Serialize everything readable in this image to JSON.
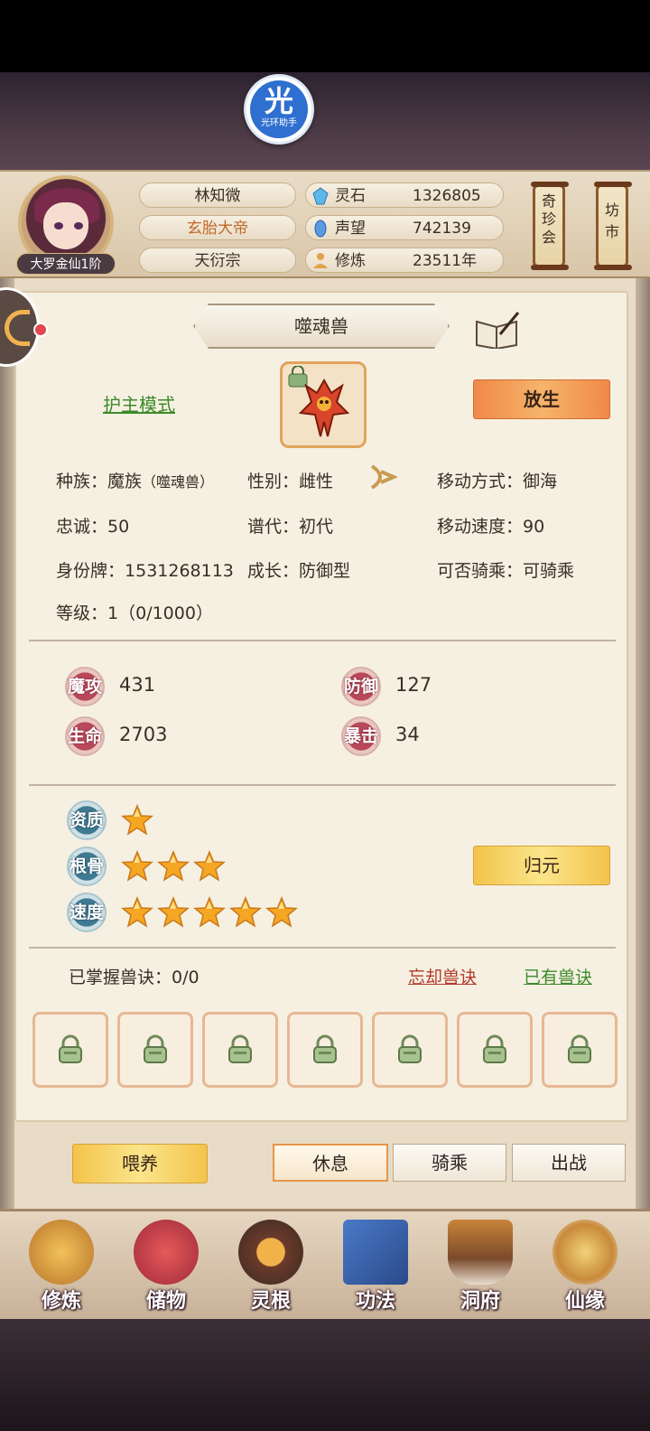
{
  "app_badge": {
    "glyph": "光",
    "text": "光环助手"
  },
  "player": {
    "rank": "大罗金仙1阶",
    "name": "林知微",
    "title": "玄胎大帝",
    "sect": "天衍宗"
  },
  "resources": [
    {
      "icon": "spirit-stone-icon",
      "label": "灵石",
      "value": "1326805"
    },
    {
      "icon": "reputation-icon",
      "label": "声望",
      "value": "742139"
    },
    {
      "icon": "cultivation-icon",
      "label": "修炼",
      "value": "23511年"
    }
  ],
  "scrolls": {
    "left": "奇珍会",
    "right": "坊市"
  },
  "beast": {
    "name": "噬魂兽",
    "mode_link": "护主模式",
    "release_button": "放生",
    "info": {
      "race_label": "种族：",
      "race_value": "魔族",
      "race_sub": "（噬魂兽）",
      "gender_label": "性别：",
      "gender_value": "雌性",
      "move_label": "移动方式：",
      "move_value": "御海",
      "loyalty_label": "忠诚：",
      "loyalty_value": "50",
      "gen_label": "谱代：",
      "gen_value": "初代",
      "speed_label": "移动速度：",
      "speed_value": "90",
      "id_label": "身份牌：",
      "id_value": "1531268113",
      "growth_label": "成长：",
      "growth_value": "防御型",
      "ride_label": "可否骑乘：",
      "ride_value": "可骑乘",
      "level_label": "等级：",
      "level_value": "1（0/1000）"
    },
    "stats": [
      {
        "name": "魔攻",
        "value": "431"
      },
      {
        "name": "防御",
        "value": "127"
      },
      {
        "name": "生命",
        "value": "2703"
      },
      {
        "name": "暴击",
        "value": "34"
      }
    ],
    "aptitudes": [
      {
        "name": "资质",
        "stars": 1
      },
      {
        "name": "根骨",
        "stars": 3
      },
      {
        "name": "速度",
        "stars": 5
      }
    ],
    "return_button": "归元",
    "skills": {
      "label": "已掌握兽诀：0/0",
      "forget_link": "忘却兽诀",
      "owned_link": "已有兽诀",
      "slot_count": 7
    }
  },
  "actions": {
    "feed": "喂养",
    "tabs": [
      "休息",
      "骑乘",
      "出战"
    ],
    "active_tab": "休息"
  },
  "nav": [
    {
      "label": "修炼",
      "icon": "cultivate-icon"
    },
    {
      "label": "储物",
      "icon": "storage-bag-icon"
    },
    {
      "label": "灵根",
      "icon": "spirit-root-icon"
    },
    {
      "label": "功法",
      "icon": "technique-book-icon"
    },
    {
      "label": "洞府",
      "icon": "cave-mansion-icon"
    },
    {
      "label": "仙缘",
      "icon": "fate-icon"
    }
  ],
  "colors": {
    "panel_bg": "#f6f0e2",
    "accent_orange": "#f0884a",
    "accent_gold": "#f3c34b",
    "link_green": "#3c8a2a",
    "link_red": "#b23a2a",
    "stat_badge": "#b9495a",
    "aptitude_badge": "#3f7a92"
  }
}
